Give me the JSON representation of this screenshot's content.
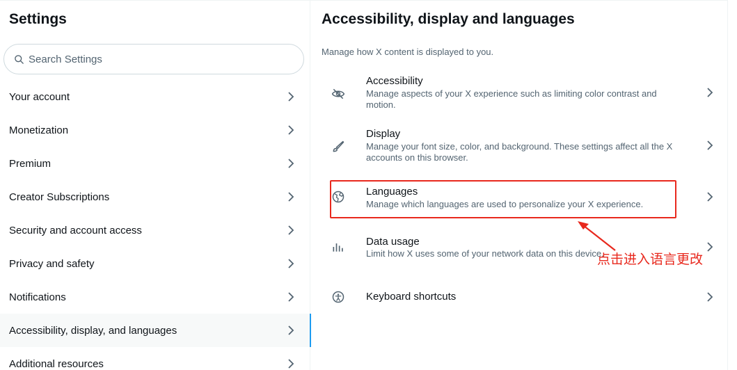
{
  "left": {
    "title": "Settings",
    "search_placeholder": "Search Settings",
    "items": [
      {
        "label": "Your account"
      },
      {
        "label": "Monetization"
      },
      {
        "label": "Premium"
      },
      {
        "label": "Creator Subscriptions"
      },
      {
        "label": "Security and account access"
      },
      {
        "label": "Privacy and safety"
      },
      {
        "label": "Notifications"
      },
      {
        "label": "Accessibility, display, and languages",
        "active": true
      },
      {
        "label": "Additional resources"
      }
    ]
  },
  "right": {
    "title": "Accessibility, display and languages",
    "subtitle": "Manage how X content is displayed to you.",
    "rows": [
      {
        "icon": "eye-slash-icon",
        "title": "Accessibility",
        "desc": "Manage aspects of your X experience such as limiting color contrast and motion."
      },
      {
        "icon": "brush-icon",
        "title": "Display",
        "desc": "Manage your font size, color, and background. These settings affect all the X accounts on this browser."
      },
      {
        "icon": "globe-icon",
        "title": "Languages",
        "desc": "Manage which languages are used to personalize your X experience."
      },
      {
        "icon": "bar-chart-icon",
        "title": "Data usage",
        "desc": "Limit how X uses some of your network data on this device."
      },
      {
        "icon": "accessibility-person-icon",
        "title": "Keyboard shortcuts",
        "desc": ""
      }
    ]
  },
  "annotation": {
    "text": "点击进入语言更改",
    "color": "#e8281d"
  },
  "colors": {
    "accent": "#1d9bf0",
    "text": "#0f1419",
    "secondary": "#536471"
  }
}
